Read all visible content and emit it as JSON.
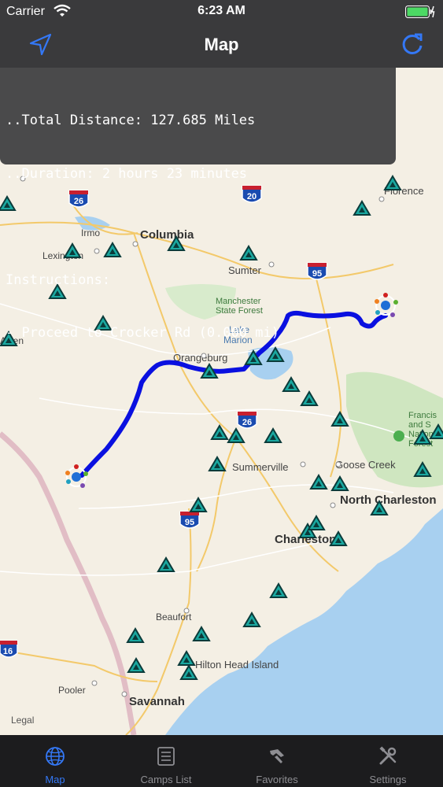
{
  "status_bar": {
    "carrier": "Carrier",
    "time": "6:23 AM"
  },
  "nav": {
    "title": "Map",
    "left_icon": "location-arrow-icon",
    "right_icon": "refresh-icon"
  },
  "info_panel": {
    "total_distance": "..Total Distance: 127.685 Miles",
    "duration": "..Duration: 2 hours 23 minutes",
    "instructions_label": "Instructions:",
    "step_1": "- Proceed to Crocker Rd (0.000 mi)"
  },
  "map": {
    "cities": {
      "florence": "Florence",
      "irmo": "Irmo",
      "columbia": "Columbia",
      "lexington": "Lexington",
      "sumter": "Sumter",
      "manchester": "Manchester\nState Forest",
      "lake_marion": "Lake\nMarion",
      "aiken": "Aiken",
      "orangeburg": "Orangeburg",
      "summerville": "Summerville",
      "goose_creek": "Goose Creek",
      "north_charleston": "North Charleston",
      "charleston": "Charleston",
      "francis_marion": "Francis\nand S\nNational\nForest",
      "beaufort": "Beaufort",
      "hilton_head": "Hilton Head Island",
      "pooler": "Pooler",
      "savannah": "Savannah"
    },
    "shields": {
      "i26_top": "26",
      "i20": "20",
      "i95_top": "95",
      "i26_mid": "26",
      "i95_bottom": "95",
      "i16": "16"
    },
    "legal": "Legal",
    "colors": {
      "route": "#0a10e0",
      "water": "#a8d0f0",
      "land": "#f4efe4",
      "forest": "#cfe6c0",
      "camp_marker": "#1aa8a0"
    }
  },
  "tabs": [
    {
      "label": "Map",
      "icon": "globe-icon",
      "active": true
    },
    {
      "label": "Camps List",
      "icon": "list-icon",
      "active": false
    },
    {
      "label": "Favorites",
      "icon": "favorites-icon",
      "active": false
    },
    {
      "label": "Settings",
      "icon": "settings-icon",
      "active": false
    }
  ]
}
